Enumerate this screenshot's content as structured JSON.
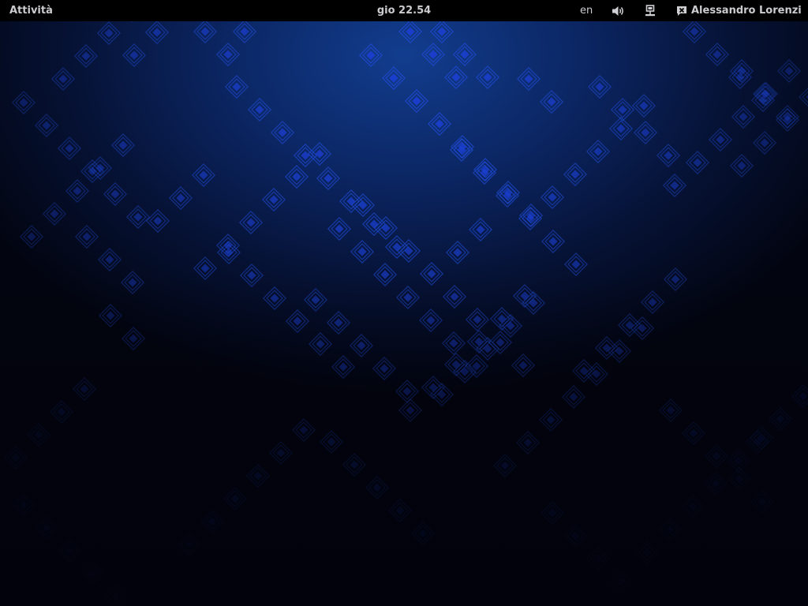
{
  "top_bar": {
    "activities_label": "Attività",
    "clock": "gio 22.54",
    "keyboard_layout": "en",
    "volume_icon": "volume-high-icon",
    "network_icon": "wired-network-icon",
    "user_status_icon": "user-busy-icon",
    "user_name": "Alessandro Lorenzi"
  },
  "wallpaper": {
    "description_colors": {
      "base": "#02040f",
      "glow": "#123d8e",
      "tile_stroke": "#1d47c9",
      "tile_fill": "#1b3fd0"
    }
  }
}
